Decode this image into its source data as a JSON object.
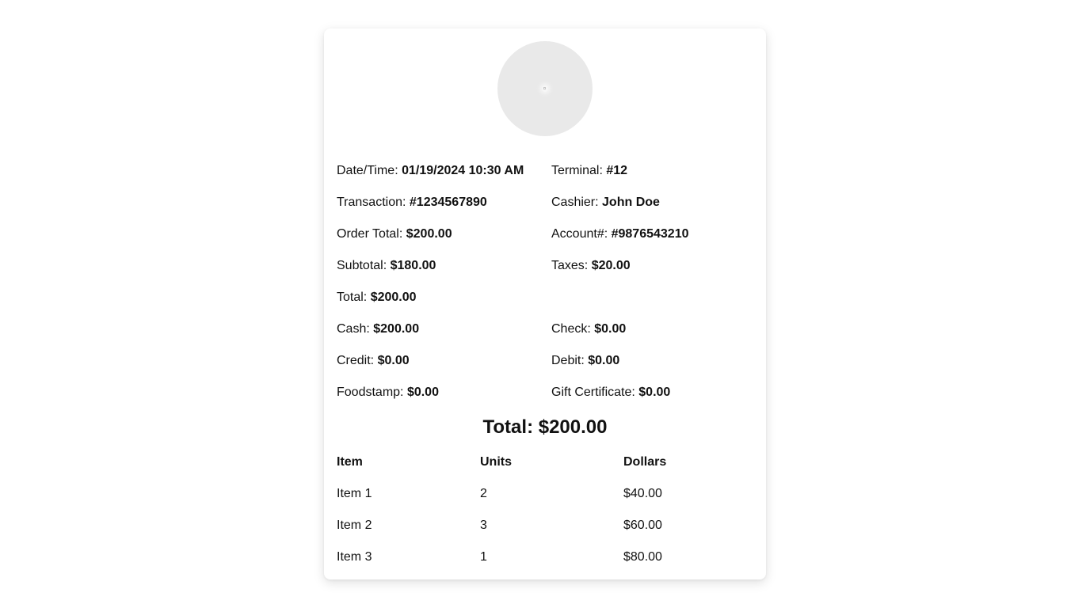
{
  "receipt": {
    "logo_icon": "store-logo-placeholder",
    "details": {
      "datetime": {
        "label": "Date/Time:",
        "value": "01/19/2024 10:30 AM"
      },
      "terminal": {
        "label": "Terminal:",
        "value": "#12"
      },
      "transaction": {
        "label": "Transaction:",
        "value": "#1234567890"
      },
      "cashier": {
        "label": "Cashier:",
        "value": "John Doe"
      },
      "order_total": {
        "label": "Order Total:",
        "value": "$200.00"
      },
      "account": {
        "label": "Account#:",
        "value": "#9876543210"
      },
      "subtotal": {
        "label": "Subtotal:",
        "value": "$180.00"
      },
      "taxes": {
        "label": "Taxes:",
        "value": "$20.00"
      },
      "total": {
        "label": "Total:",
        "value": "$200.00"
      },
      "cash": {
        "label": "Cash:",
        "value": "$200.00"
      },
      "check": {
        "label": "Check:",
        "value": "$0.00"
      },
      "credit": {
        "label": "Credit:",
        "value": "$0.00"
      },
      "debit": {
        "label": "Debit:",
        "value": "$0.00"
      },
      "foodstamp": {
        "label": "Foodstamp:",
        "value": "$0.00"
      },
      "gift_certificate": {
        "label": "Gift Certificate:",
        "value": "$0.00"
      }
    },
    "grand_total": "Total: $200.00",
    "table": {
      "headers": [
        "Item",
        "Units",
        "Dollars"
      ],
      "rows": [
        [
          "Item 1",
          "2",
          "$40.00"
        ],
        [
          "Item 2",
          "3",
          "$60.00"
        ],
        [
          "Item 3",
          "1",
          "$80.00"
        ]
      ]
    }
  }
}
